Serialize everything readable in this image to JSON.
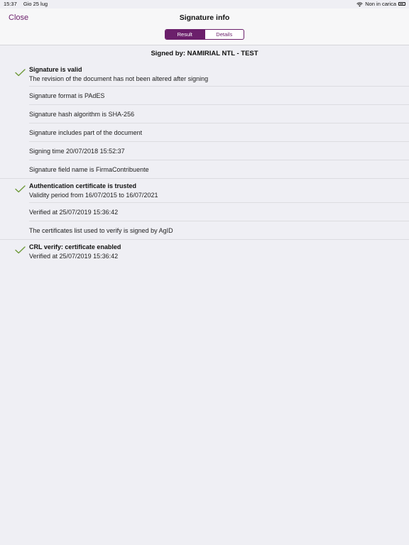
{
  "status_bar": {
    "time": "15:37",
    "date": "Gio 25 lug",
    "charging_text": "Non in carica"
  },
  "nav": {
    "close_label": "Close",
    "title": "Signature info",
    "tabs": [
      {
        "label": "Result",
        "selected": true
      },
      {
        "label": "Details",
        "selected": false
      }
    ]
  },
  "signer_title": "Signed by: NAMIRIAL NTL - TEST",
  "sections": [
    {
      "check": {
        "title": "Signature is valid",
        "subtitle": "The revision of the document has not been altered after signing"
      },
      "items": [
        "Signature format is PAdES",
        "Signature hash algorithm is SHA-256",
        "Signature includes part of the document",
        "Signing time 20/07/2018 15:52:37",
        "Signature field name is FirmaContribuente"
      ]
    },
    {
      "check": {
        "title": "Authentication certificate is trusted",
        "subtitle": "Validity period from 16/07/2015 to 16/07/2021"
      },
      "items": [
        "Verified at 25/07/2019 15:36:42",
        "The certificates list used to verify is signed by AgID"
      ]
    },
    {
      "check": {
        "title": "CRL verify: certificate enabled",
        "subtitle": "Verified at 25/07/2019 15:36:42"
      },
      "items": []
    }
  ],
  "colors": {
    "accent": "#6b1f6b",
    "check": "#6f9a3a",
    "background": "#efeff4"
  },
  "icons": {
    "status": [
      "wifi-icon",
      "battery-icon"
    ],
    "row_status": "checkmark-icon"
  }
}
